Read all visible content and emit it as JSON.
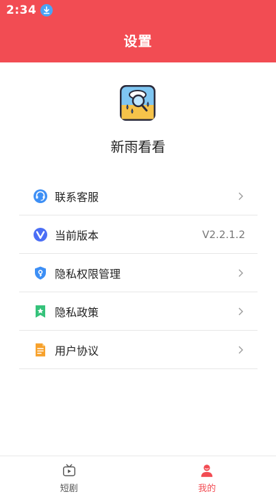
{
  "status_bar": {
    "time": "2:34"
  },
  "header": {
    "title": "设置"
  },
  "app": {
    "name": "新雨看看"
  },
  "menu": {
    "items": [
      {
        "label": "联系客服",
        "icon": "customer-service-icon"
      },
      {
        "label": "当前版本",
        "icon": "version-icon",
        "value": "V2.2.1.2"
      },
      {
        "label": "隐私权限管理",
        "icon": "privacy-shield-icon"
      },
      {
        "label": "隐私政策",
        "icon": "bookmark-star-icon"
      },
      {
        "label": "用户协议",
        "icon": "document-icon"
      }
    ]
  },
  "tabbar": {
    "tabs": [
      {
        "label": "短剧",
        "icon": "tv-icon",
        "active": false
      },
      {
        "label": "我的",
        "icon": "profile-icon",
        "active": true
      }
    ]
  },
  "colors": {
    "accent": "#f24c53",
    "divider": "#e6e6e6"
  }
}
